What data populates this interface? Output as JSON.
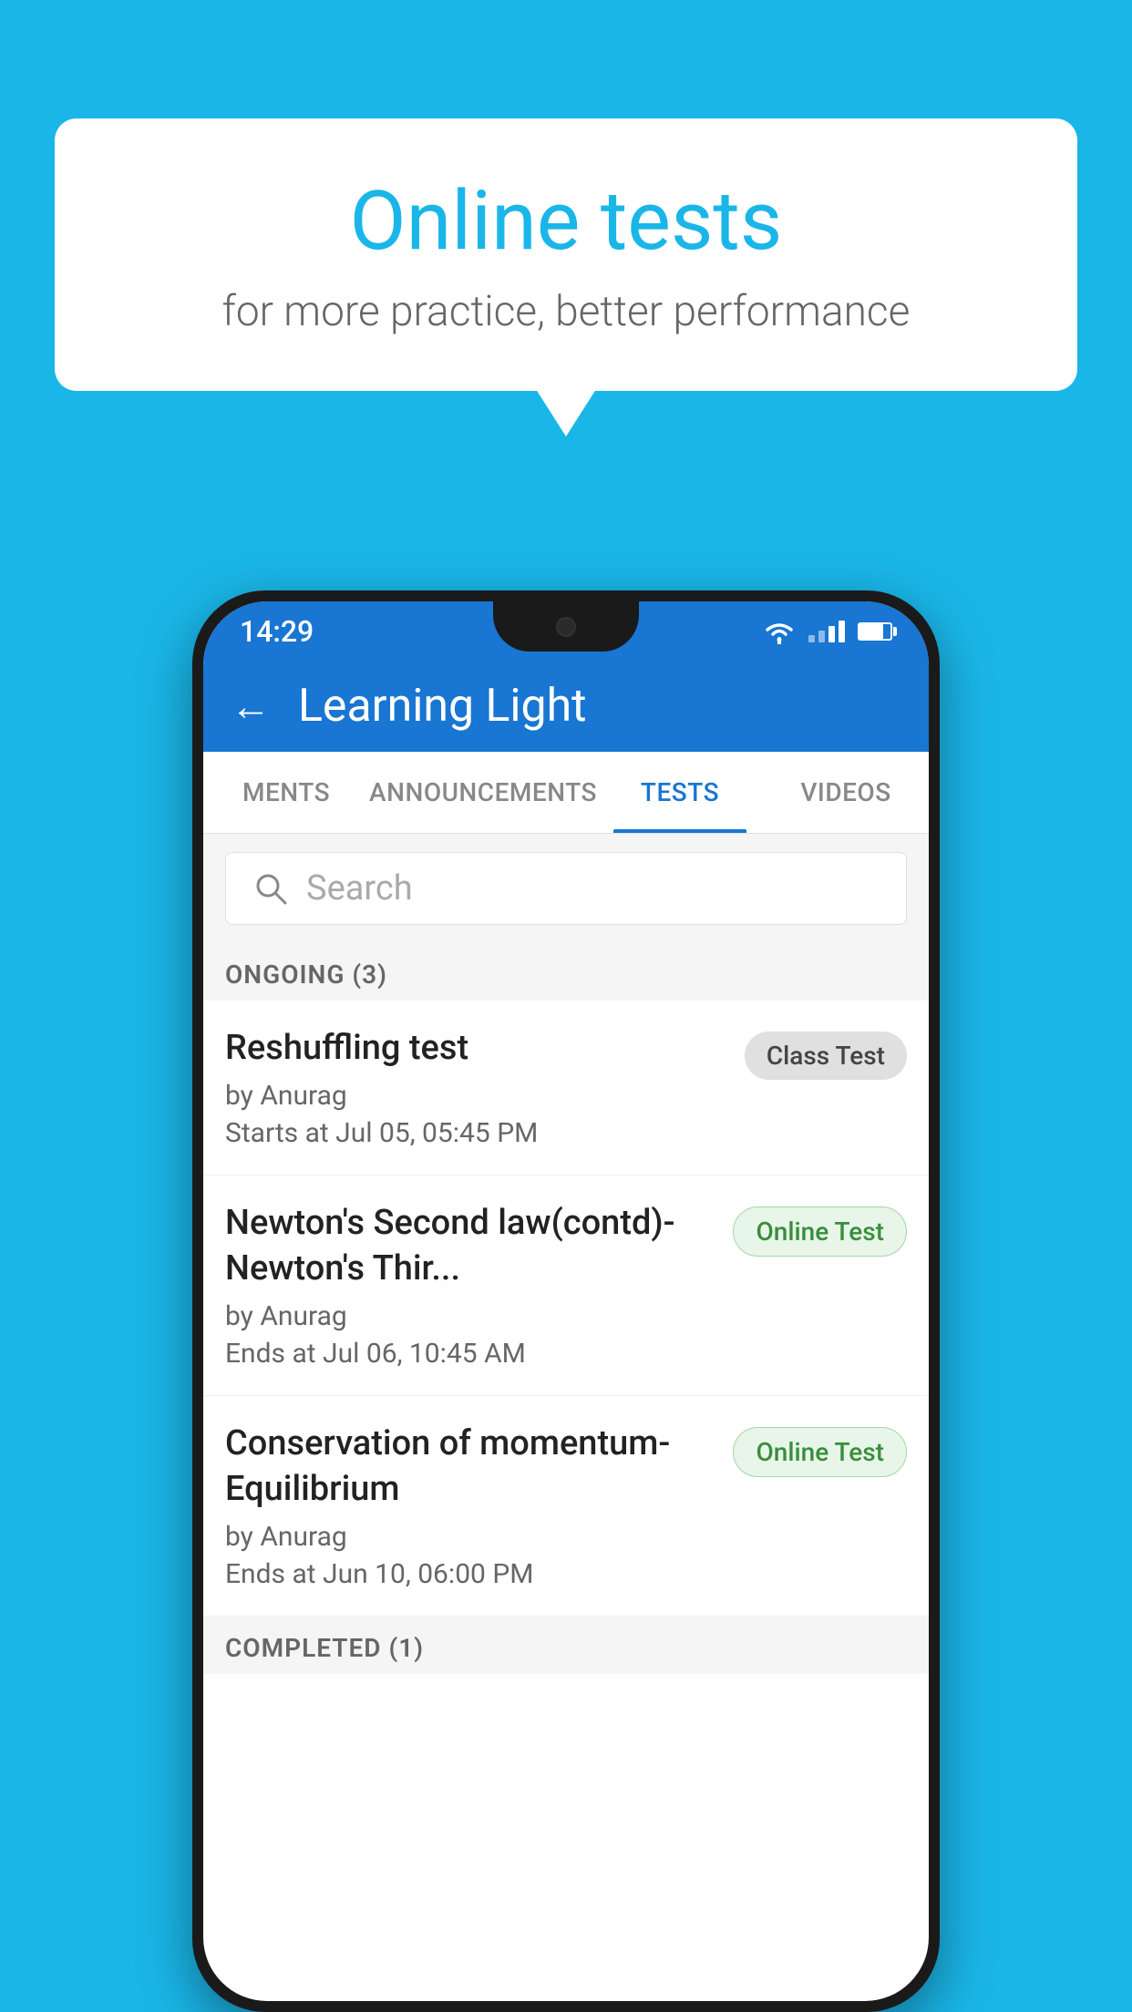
{
  "background": {
    "color": "#1ab6e8"
  },
  "speech_bubble": {
    "title": "Online tests",
    "subtitle": "for more practice, better performance"
  },
  "status_bar": {
    "time": "14:29"
  },
  "app_bar": {
    "title": "Learning Light",
    "back_label": "←"
  },
  "tabs": [
    {
      "label": "MENTS",
      "active": false
    },
    {
      "label": "ANNOUNCEMENTS",
      "active": false
    },
    {
      "label": "TESTS",
      "active": true
    },
    {
      "label": "VIDEOS",
      "active": false
    }
  ],
  "search": {
    "placeholder": "Search"
  },
  "sections": {
    "ongoing": {
      "title": "ONGOING (3)",
      "tests": [
        {
          "name": "Reshuffling test",
          "author": "by Anurag",
          "time": "Starts at  Jul 05, 05:45 PM",
          "badge": "Class Test",
          "badge_type": "class"
        },
        {
          "name": "Newton's Second law(contd)-Newton's Thir...",
          "author": "by Anurag",
          "time": "Ends at  Jul 06, 10:45 AM",
          "badge": "Online Test",
          "badge_type": "online"
        },
        {
          "name": "Conservation of momentum-Equilibrium",
          "author": "by Anurag",
          "time": "Ends at  Jun 10, 06:00 PM",
          "badge": "Online Test",
          "badge_type": "online"
        }
      ]
    },
    "completed": {
      "title": "COMPLETED (1)"
    }
  }
}
